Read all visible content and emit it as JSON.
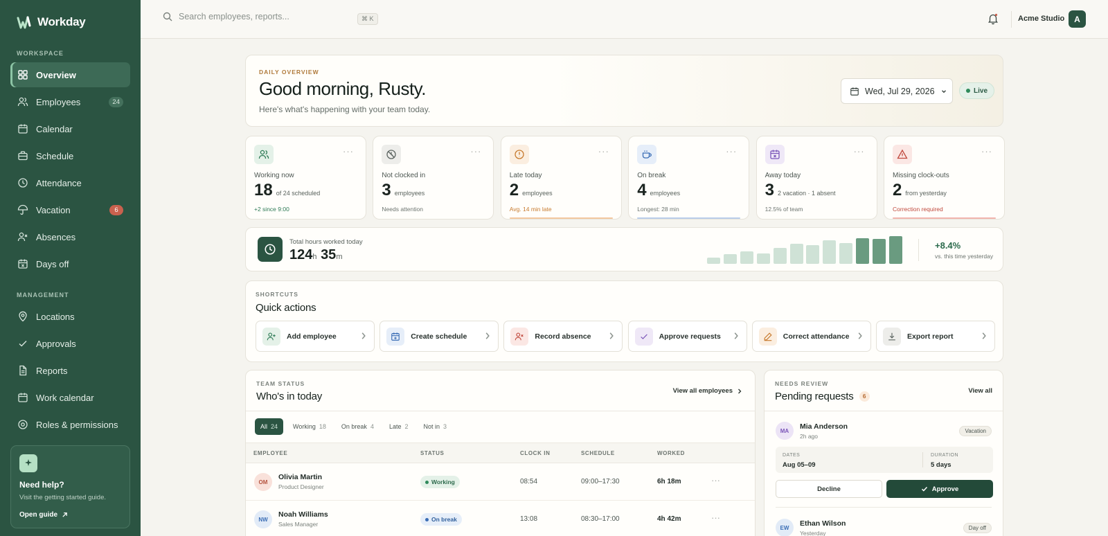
{
  "app": {
    "name": "Workday"
  },
  "sidebar": {
    "workspace_label": "WORKSPACE",
    "management_label": "MANAGEMENT",
    "items": [
      {
        "label": "Overview",
        "icon": "grid-icon",
        "active": true
      },
      {
        "label": "Employees",
        "icon": "users-icon",
        "badge": "24"
      },
      {
        "label": "Calendar",
        "icon": "calendar-icon"
      },
      {
        "label": "Schedule",
        "icon": "briefcase-icon"
      },
      {
        "label": "Attendance",
        "icon": "clock-icon"
      },
      {
        "label": "Vacation",
        "icon": "umbrella-icon",
        "badge": "6"
      },
      {
        "label": "Absences",
        "icon": "user-x-icon"
      },
      {
        "label": "Days off",
        "icon": "calendar-x-icon"
      }
    ],
    "management": [
      {
        "label": "Locations",
        "icon": "map-pin-icon"
      },
      {
        "label": "Approvals",
        "icon": "check-icon"
      },
      {
        "label": "Reports",
        "icon": "file-icon"
      },
      {
        "label": "Work calendar",
        "icon": "calendar-icon"
      },
      {
        "label": "Roles & permissions",
        "icon": "gear-icon"
      }
    ],
    "help": {
      "title": "Need help?",
      "text": "Visit the getting started guide.",
      "link": "Open guide"
    }
  },
  "topbar": {
    "search_placeholder": "Search employees, reports...",
    "shortcut": "⌘ K",
    "org_name": "Acme Studio",
    "avatar_initial": "A"
  },
  "hero": {
    "eyebrow": "DAILY OVERVIEW",
    "greeting": "Good morning, Rusty.",
    "subtitle": "Here's what's happening with your team today.",
    "date": "Wed, Jul 29, 2026",
    "live": "Live"
  },
  "stats": [
    {
      "label": "Working now",
      "value": "18",
      "unit": "of 24 scheduled",
      "foot": "+2 since 9:00",
      "icon": "users-icon",
      "color": "#2d7a55",
      "bg": "#e4f1e8",
      "bar": ""
    },
    {
      "label": "Not clocked in",
      "value": "3",
      "unit": "employees",
      "foot": "Needs attention",
      "icon": "clock-off-icon",
      "color": "#5b6460",
      "bg": "#ededea",
      "bar": ""
    },
    {
      "label": "Late today",
      "value": "2",
      "unit": "employees",
      "foot": "Avg. 14 min late",
      "icon": "alert-circle-icon",
      "color": "#c77a2e",
      "bg": "#fbeee0",
      "bar": "#f3c89f"
    },
    {
      "label": "On break",
      "value": "4",
      "unit": "employees",
      "foot": "Longest: 28 min",
      "icon": "coffee-icon",
      "color": "#3a6db5",
      "bg": "#e6eef9",
      "bar": "#b9cdea"
    },
    {
      "label": "Away today",
      "value": "3",
      "unit": "2 vacation · 1 absent",
      "foot": "12.5% of team",
      "icon": "calendar-x-icon",
      "color": "#7a55b8",
      "bg": "#efe8f7",
      "bar": ""
    },
    {
      "label": "Missing clock-outs",
      "value": "2",
      "unit": "from yesterday",
      "foot": "Correction required",
      "icon": "alert-triangle-icon",
      "color": "#c0483c",
      "bg": "#fbe7e4",
      "bar": "#f1b5ad"
    }
  ],
  "hours": {
    "label": "Total hours worked today",
    "hours": "124",
    "h_unit": "h",
    "minutes": "35",
    "m_unit": "m",
    "change": "+8.4%",
    "change_note": "vs. this time yesterday",
    "bars": [
      0.22,
      0.35,
      0.45,
      0.38,
      0.58,
      0.73,
      0.68,
      0.85,
      0.76,
      0.92,
      0.9,
      1.0
    ],
    "highlight_from": 9
  },
  "quick_actions": {
    "eyebrow": "SHORTCUTS",
    "title": "Quick actions",
    "items": [
      {
        "label": "Add employee",
        "icon": "user-plus-icon",
        "color": "#2d7a55",
        "bg": "#e4f1e8"
      },
      {
        "label": "Create schedule",
        "icon": "calendar-plus-icon",
        "color": "#3a6db5",
        "bg": "#e6eef9"
      },
      {
        "label": "Record absence",
        "icon": "user-x-icon",
        "color": "#c0483c",
        "bg": "#fbe7e4"
      },
      {
        "label": "Approve requests",
        "icon": "check-icon",
        "color": "#7a55b8",
        "bg": "#efe8f7"
      },
      {
        "label": "Correct attendance",
        "icon": "pencil-icon",
        "color": "#c77a2e",
        "bg": "#fbeee0"
      },
      {
        "label": "Export report",
        "icon": "download-icon",
        "color": "#5b6460",
        "bg": "#ededea"
      }
    ]
  },
  "team": {
    "eyebrow": "TEAM STATUS",
    "title": "Who's in today",
    "view_all": "View all employees",
    "filters": [
      {
        "label": "All",
        "count": "24"
      },
      {
        "label": "Working",
        "count": "18"
      },
      {
        "label": "On break",
        "count": "4"
      },
      {
        "label": "Late",
        "count": "2"
      },
      {
        "label": "Not in",
        "count": "3"
      }
    ],
    "columns": [
      "EMPLOYEE",
      "STATUS",
      "CLOCK IN",
      "SCHEDULE",
      "WORKED"
    ],
    "rows": [
      {
        "initials": "OM",
        "name": "Olivia Martin",
        "role": "Product Designer",
        "status": "Working",
        "clock_in": "08:54",
        "schedule": "09:00–17:30",
        "worked": "6h 18m",
        "av_bg": "#f9e1da",
        "av_color": "#b4533f",
        "pill_bg": "#e4f1e8",
        "pill_color": "#2d6a4c",
        "dot": "#2f8a5b"
      },
      {
        "initials": "NW",
        "name": "Noah Williams",
        "role": "Sales Manager",
        "status": "On break",
        "clock_in": "13:08",
        "schedule": "08:30–17:00",
        "worked": "4h 42m",
        "av_bg": "#e2ebf7",
        "av_color": "#3a6db5",
        "pill_bg": "#e6eef9",
        "pill_color": "#2f5f9c",
        "dot": "#3a6db5"
      }
    ]
  },
  "pending": {
    "eyebrow": "NEEDS REVIEW",
    "title": "Pending requests",
    "count": "6",
    "view_all": "View all",
    "requests": [
      {
        "initials": "MA",
        "name": "Mia Anderson",
        "time": "2h ago",
        "type": "Vacation",
        "dates_label": "DATES",
        "dates": "Aug 05–09",
        "duration_label": "DURATION",
        "duration": "5 days",
        "decline": "Decline",
        "approve": "Approve"
      },
      {
        "initials": "EW",
        "name": "Ethan Wilson",
        "time": "Yesterday",
        "type": "Day off"
      }
    ]
  }
}
